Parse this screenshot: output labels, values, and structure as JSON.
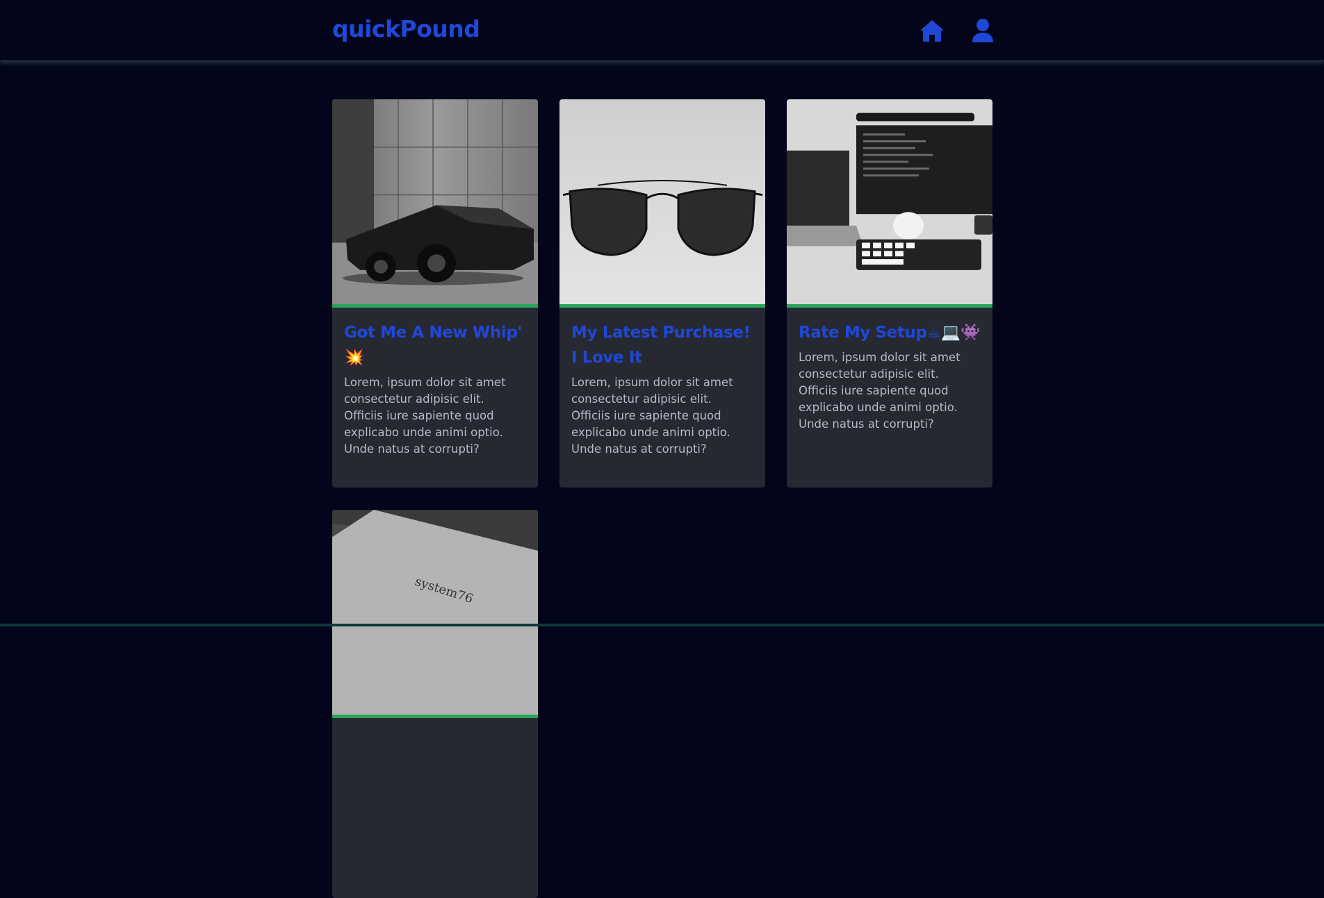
{
  "navbar": {
    "brand": "quickPound",
    "icons": [
      "home-icon",
      "user-icon"
    ],
    "accent": "#1f48d8"
  },
  "posts": [
    {
      "title": "Got Me A New Whip' 💥",
      "body": "Lorem, ipsum dolor sit amet consectetur adipisic elit. Officiis iure sapiente quod explicabo unde animi optio. Unde natus at corrupti?",
      "image": "car-photo"
    },
    {
      "title": "My Latest Purchase! I Love It",
      "body": "Lorem, ipsum dolor sit amet consectetur adipisic elit. Officiis iure sapiente quod explicabo unde animi optio. Unde natus at corrupti?",
      "image": "sunglasses-photo"
    },
    {
      "title": "Rate My Setup☕💻👾",
      "body": "Lorem, ipsum dolor sit amet consectetur adipisic elit. Officiis iure sapiente quod explicabo unde animi optio. Unde natus at corrupti?",
      "image": "desk-setup-photo"
    },
    {
      "image": "laptop-photo",
      "image_text": "system76"
    }
  ],
  "colors": {
    "background": "#03061a",
    "card": "#262932",
    "divider": "#25a45a",
    "title": "#1f48d8",
    "body_text": "#b6bac6"
  }
}
